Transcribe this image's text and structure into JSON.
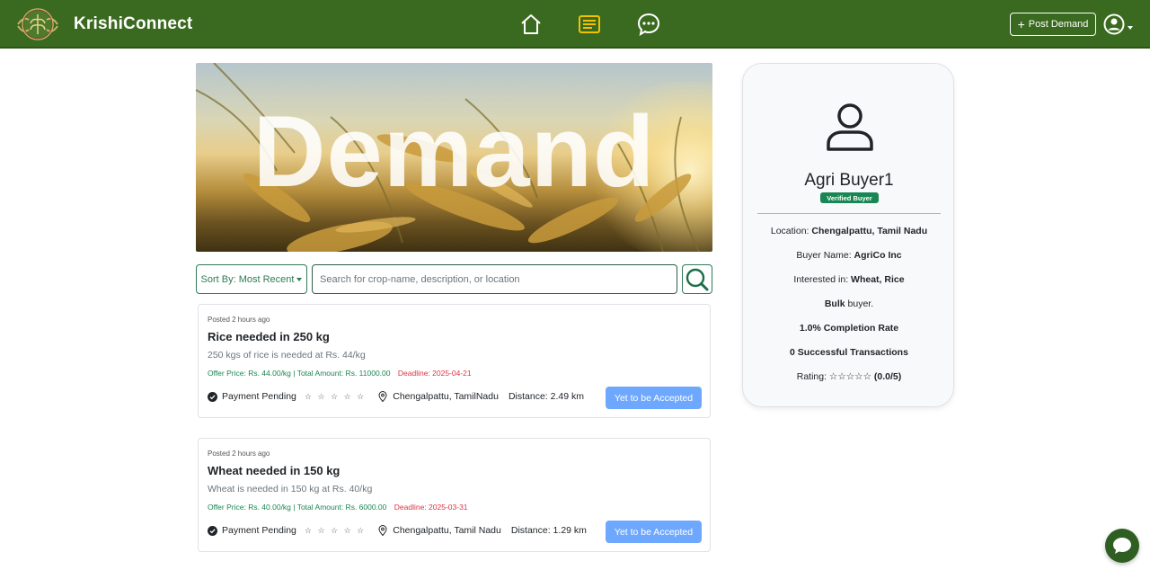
{
  "nav": {
    "brand": "KrishiConnect",
    "post_demand_label": "Post Demand",
    "active_tab": "demands",
    "icons": [
      "home-icon",
      "demands-icon",
      "chat-icon"
    ]
  },
  "hero": {
    "title": "Demand"
  },
  "search": {
    "sort_label": "Sort By: Most Recent",
    "placeholder": "Search for crop-name, description, or location"
  },
  "demands": [
    {
      "posted": "Posted 2 hours ago",
      "title": "Rice needed in 250 kg",
      "description": "250 kgs of rice is needed at Rs. 44/kg",
      "price": "Offer Price: Rs. 44.00/kg | Total Amount: Rs. 11000.00",
      "deadline": "Deadline: 2025-04-21",
      "payment_status": "Payment Pending",
      "stars": "☆ ☆ ☆ ☆ ☆",
      "location": "Chengalpattu, TamilNadu",
      "distance": "Distance: 2.49 km",
      "status_button": "Yet to be Accepted"
    },
    {
      "posted": "Posted 2 hours ago",
      "title": "Wheat needed in 150 kg",
      "description": "Wheat is needed in 150 kg at Rs. 40/kg",
      "price": "Offer Price: Rs. 40.00/kg | Total Amount: Rs. 6000.00",
      "deadline": "Deadline: 2025-03-31",
      "payment_status": "Payment Pending",
      "stars": "☆ ☆ ☆ ☆ ☆",
      "location": "Chengalpattu, Tamil Nadu",
      "distance": "Distance: 1.29 km",
      "status_button": "Yet to be Accepted"
    }
  ],
  "profile": {
    "name": "Agri Buyer1",
    "badge": "Verified Buyer",
    "location_label": "Location: ",
    "location_value": "Chengalpattu, Tamil Nadu",
    "buyer_name_label": "Buyer Name: ",
    "buyer_name_value": "AgriCo Inc",
    "interested_label": "Interested in: ",
    "interested_value": "Wheat, Rice",
    "bulk_bold": "Bulk",
    "bulk_rest": " buyer.",
    "completion_rate": "1.0% Completion Rate",
    "transactions": "0 Successful Transactions",
    "rating_label": "Rating: ",
    "rating_value": "☆☆☆☆☆ (0.0/5)"
  },
  "colors": {
    "navbar": "#3a6a1f",
    "accent_green": "#198754",
    "active_icon": "#f2c200",
    "deadline_red": "#dc3545",
    "status_button": "#6ea8fe"
  }
}
